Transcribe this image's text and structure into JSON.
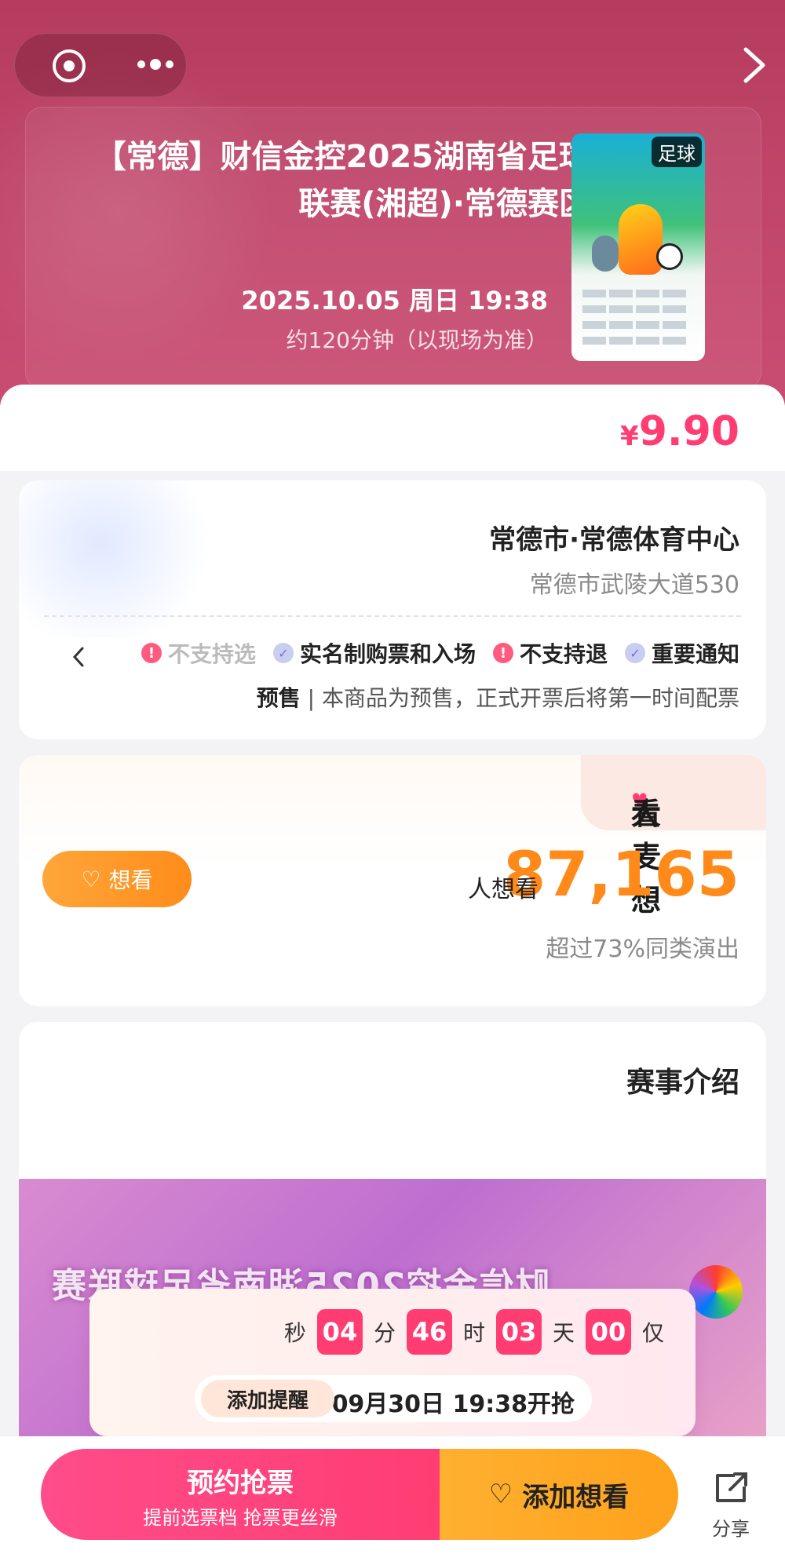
{
  "header": {
    "title": "【常德】财信金控2025湖南省足球联赛(湘超)·常德赛区",
    "date": "2025.10.05 周日 19:38",
    "duration": "约120分钟（以现场为准）",
    "poster_tag": "足球"
  },
  "price": {
    "symbol": "¥",
    "value": "9.90"
  },
  "venue": {
    "name": "常德市·常德体育中心",
    "address": "常德市武陵大道530",
    "notices": [
      {
        "label": "重要通知",
        "icon": "check-circle-icon"
      },
      {
        "label": "不支持退",
        "icon": "warning-icon"
      },
      {
        "label": "实名制购票和入场",
        "icon": "check-circle-icon"
      },
      {
        "label": "不支持选",
        "icon": "warning-icon"
      }
    ],
    "presale_tag": "预售",
    "presale_text": "本商品为预售，正式开票后将第一时间配票"
  },
  "want": {
    "tab_title_a": "大麦想",
    "tab_title_b": "看",
    "count": "87,165",
    "unit": "人想看",
    "compare": "超过73%同类演出",
    "button": "想看"
  },
  "intro": {
    "title": "赛事介绍",
    "banner_text": "财信金控2025湖南省足球联赛"
  },
  "countdown": {
    "prefix": "仅",
    "days": "00",
    "days_label": "天",
    "hours": "03",
    "hours_label": "时",
    "minutes": "46",
    "minutes_label": "分",
    "seconds": "04",
    "seconds_label": "秒",
    "open_time": "09月30日 19:38开抢",
    "remind_button": "添加提醒"
  },
  "bottom_bar": {
    "share_label": "分享",
    "reserve_main": "预约抢票",
    "reserve_sub": "提前选票档 抢票更丝滑",
    "want_label": "添加想看"
  },
  "colors": {
    "brand_pink": "#ff3d73",
    "orange": "#ff8a1a",
    "header_bg": "#c0456a"
  }
}
